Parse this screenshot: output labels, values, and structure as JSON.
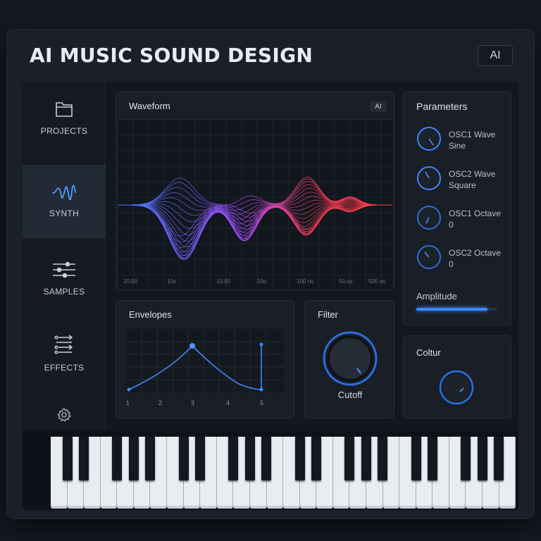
{
  "app": {
    "title": "AI MUSIC SOUND DESIGN",
    "badge": "AI"
  },
  "sidebar": {
    "items": [
      {
        "label": "PROJECTS",
        "icon": "folder-icon"
      },
      {
        "label": "SYNTH",
        "icon": "waveform-icon",
        "active": true
      },
      {
        "label": "SAMPLES",
        "icon": "sliders-icon"
      },
      {
        "label": "EFFECTS",
        "icon": "effects-icon"
      }
    ],
    "settings_icon": "gear-icon"
  },
  "waveform": {
    "title": "Waveform",
    "badge": "AI",
    "ticks": [
      "20:00",
      "10o",
      "10.00",
      "00o",
      "100 ns",
      "50.os",
      "500 os"
    ]
  },
  "parameters": {
    "title": "Parameters",
    "items": [
      {
        "name": "OSC1 Wave",
        "value": "Sine"
      },
      {
        "name": "OSC2 Wave",
        "value": "Square"
      },
      {
        "name": "OSC1 Octave",
        "value": "0"
      },
      {
        "name": "OSC2 Octave",
        "value": "0"
      }
    ],
    "amplitude": {
      "label": "Amplitude",
      "level": 0.88
    }
  },
  "envelopes": {
    "title": "Envelopes",
    "axis": [
      "1",
      "2",
      "3",
      "4",
      "5"
    ]
  },
  "filter": {
    "title": "Filter",
    "knob_label": "Cutoff"
  },
  "color_panel": {
    "title": "Coltur"
  },
  "colors": {
    "accent": "#3e88ff",
    "wave_start": "#3a7bff",
    "wave_mid": "#a44dff",
    "wave_end": "#ff3d3d"
  }
}
